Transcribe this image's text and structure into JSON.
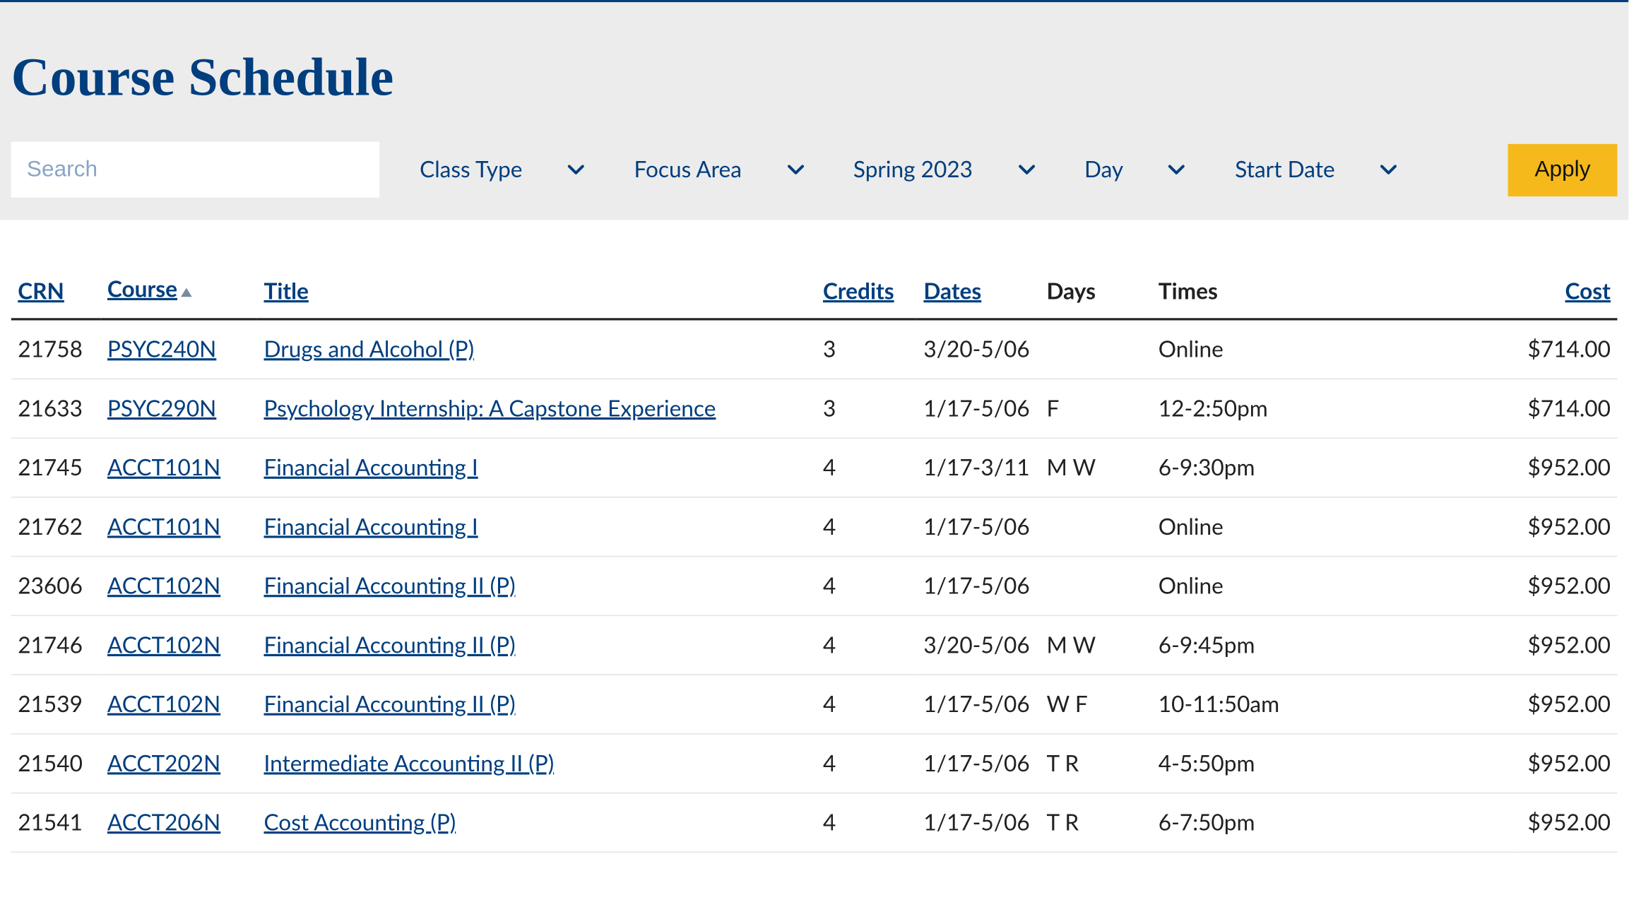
{
  "page": {
    "title": "Course Schedule"
  },
  "filters": {
    "search_placeholder": "Search",
    "class_type_label": "Class Type",
    "focus_area_label": "Focus Area",
    "term_label": "Spring 2023",
    "day_label": "Day",
    "start_date_label": "Start Date",
    "apply_label": "Apply"
  },
  "columns": {
    "crn": "CRN",
    "course": "Course",
    "title": "Title",
    "credits": "Credits",
    "dates": "Dates",
    "days": "Days",
    "times": "Times",
    "cost": "Cost"
  },
  "sort": {
    "column": "course",
    "direction": "asc"
  },
  "rows": [
    {
      "crn": "21758",
      "course": "PSYC240N",
      "title": "Drugs and Alcohol (P)",
      "credits": "3",
      "dates": "3/20-5/06",
      "days": "",
      "times": "Online",
      "cost": "$714.00"
    },
    {
      "crn": "21633",
      "course": "PSYC290N",
      "title": "Psychology Internship: A Capstone Experience",
      "credits": "3",
      "dates": "1/17-5/06",
      "days": "F",
      "times": "12-2:50pm",
      "cost": "$714.00"
    },
    {
      "crn": "21745",
      "course": "ACCT101N",
      "title": "Financial Accounting I",
      "credits": "4",
      "dates": "1/17-3/11",
      "days": "M W",
      "times": "6-9:30pm",
      "cost": "$952.00"
    },
    {
      "crn": "21762",
      "course": "ACCT101N",
      "title": "Financial Accounting I",
      "credits": "4",
      "dates": "1/17-5/06",
      "days": "",
      "times": "Online",
      "cost": "$952.00"
    },
    {
      "crn": "23606",
      "course": "ACCT102N",
      "title": "Financial Accounting II (P)",
      "credits": "4",
      "dates": "1/17-5/06",
      "days": "",
      "times": "Online",
      "cost": "$952.00"
    },
    {
      "crn": "21746",
      "course": "ACCT102N",
      "title": "Financial Accounting II (P)",
      "credits": "4",
      "dates": "3/20-5/06",
      "days": "M W",
      "times": "6-9:45pm",
      "cost": "$952.00"
    },
    {
      "crn": "21539",
      "course": "ACCT102N",
      "title": "Financial Accounting II (P)",
      "credits": "4",
      "dates": "1/17-5/06",
      "days": "W F",
      "times": "10-11:50am",
      "cost": "$952.00"
    },
    {
      "crn": "21540",
      "course": "ACCT202N",
      "title": "Intermediate Accounting II (P)",
      "credits": "4",
      "dates": "1/17-5/06",
      "days": "T R",
      "times": "4-5:50pm",
      "cost": "$952.00"
    },
    {
      "crn": "21541",
      "course": "ACCT206N",
      "title": "Cost Accounting (P)",
      "credits": "4",
      "dates": "1/17-5/06",
      "days": "T R",
      "times": "6-7:50pm",
      "cost": "$952.00"
    }
  ]
}
